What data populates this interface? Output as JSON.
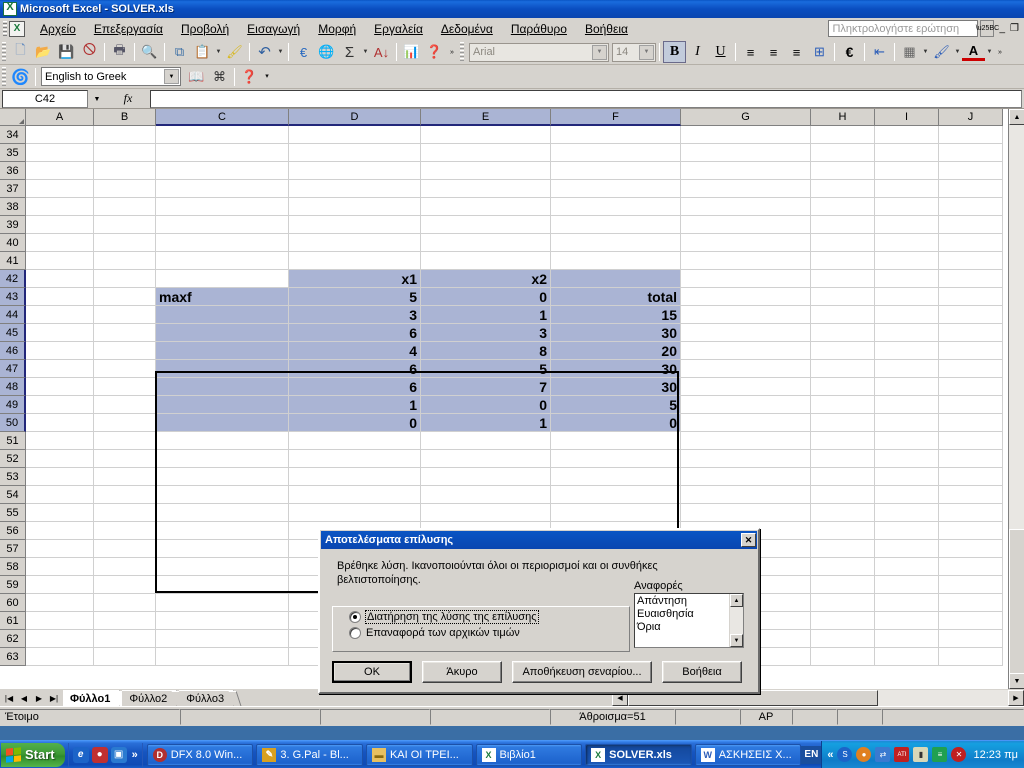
{
  "window": {
    "title": "Microsoft Excel - SOLVER.xls",
    "app_icon": "excel-icon",
    "minimize": "_",
    "restore": "❐",
    "close": "✕"
  },
  "menubar": {
    "items": [
      {
        "label": "Αρχείο",
        "accel": "Α"
      },
      {
        "label": "Επεξεργασία",
        "accel": "Ε"
      },
      {
        "label": "Προβολή",
        "accel": "ρ"
      },
      {
        "label": "Εισαγωγή",
        "accel": "ω"
      },
      {
        "label": "Μορφή",
        "accel": "Μ"
      },
      {
        "label": "Εργαλεία",
        "accel": "λ"
      },
      {
        "label": "Δεδομένα",
        "accel": "Δ"
      },
      {
        "label": "Παράθυρο",
        "accel": "θ"
      },
      {
        "label": "Βοήθεια",
        "accel": "Β"
      }
    ],
    "ask_box_placeholder": "Πληκτρολογήστε ερώτηση"
  },
  "standard_toolbar": {
    "buttons": [
      {
        "name": "new-icon",
        "glyph": "📄"
      },
      {
        "name": "open-icon",
        "glyph": "📂"
      },
      {
        "name": "save-icon",
        "glyph": "💾"
      },
      {
        "name": "permission-icon",
        "glyph": "📑"
      },
      {
        "name": "print-icon",
        "glyph": "🖨"
      },
      {
        "name": "print-preview-icon",
        "glyph": "🔍"
      },
      {
        "name": "copy-icon",
        "glyph": "⧉"
      },
      {
        "name": "paste-icon",
        "glyph": "📋"
      },
      {
        "name": "format-painter-icon",
        "glyph": "🖌"
      },
      {
        "name": "undo-icon",
        "glyph": "↶"
      },
      {
        "name": "euro-convert-icon",
        "glyph": "€"
      },
      {
        "name": "insert-hyperlink-icon",
        "glyph": "🌐"
      },
      {
        "name": "autosum-icon",
        "glyph": "Σ"
      },
      {
        "name": "sort-ascending-icon",
        "glyph": "↓"
      },
      {
        "name": "chart-wizard-icon",
        "glyph": "📊"
      },
      {
        "name": "help-icon",
        "glyph": "?"
      }
    ],
    "toolbar_options": "»"
  },
  "formatting_toolbar": {
    "font_name": "Arial",
    "font_size": "14",
    "bold": "B",
    "italic": "I",
    "underline": "U",
    "align_left": "≡",
    "align_center": "≡",
    "align_right": "≡",
    "merge_cells": "⊞",
    "currency": "€",
    "decrease_indent": "⇤",
    "borders": "▦",
    "fill_color": "🪣",
    "font_color": "A"
  },
  "translation_toolbar": {
    "icon": "translate-icon",
    "selected_language": "English to Greek",
    "buttons": [
      {
        "name": "dictionary-icon",
        "glyph": "📖"
      },
      {
        "name": "translate-page-icon",
        "glyph": "⌘"
      },
      {
        "name": "translation-help-icon",
        "glyph": "?"
      }
    ]
  },
  "formula_bar": {
    "name_box": "C42",
    "formula": ""
  },
  "grid": {
    "columns": [
      {
        "label": "A",
        "width": 68,
        "selected": false
      },
      {
        "label": "B",
        "width": 62,
        "selected": false
      },
      {
        "label": "C",
        "width": 133,
        "selected": true
      },
      {
        "label": "D",
        "width": 132,
        "selected": true
      },
      {
        "label": "E",
        "width": 130,
        "selected": true
      },
      {
        "label": "F",
        "width": 130,
        "selected": true
      },
      {
        "label": "G",
        "width": 130,
        "selected": false
      },
      {
        "label": "H",
        "width": 64,
        "selected": false
      },
      {
        "label": "I",
        "width": 64,
        "selected": false
      },
      {
        "label": "J",
        "width": 64,
        "selected": false
      }
    ],
    "rows": [
      {
        "num": "34",
        "selected": false,
        "cells": {}
      },
      {
        "num": "35",
        "selected": false,
        "cells": {}
      },
      {
        "num": "36",
        "selected": false,
        "cells": {}
      },
      {
        "num": "37",
        "selected": false,
        "cells": {}
      },
      {
        "num": "38",
        "selected": false,
        "cells": {}
      },
      {
        "num": "39",
        "selected": false,
        "cells": {}
      },
      {
        "num": "40",
        "selected": false,
        "cells": {}
      },
      {
        "num": "41",
        "selected": false,
        "cells": {}
      },
      {
        "num": "42",
        "selected": true,
        "cells": {
          "C": "",
          "D": "x1",
          "E": "x2",
          "F": ""
        }
      },
      {
        "num": "43",
        "selected": true,
        "cells": {
          "C": "maxf",
          "D": "5",
          "E": "0",
          "F": "total"
        }
      },
      {
        "num": "44",
        "selected": true,
        "cells": {
          "C": "",
          "D": "3",
          "E": "1",
          "F": "15"
        }
      },
      {
        "num": "45",
        "selected": true,
        "cells": {
          "C": "",
          "D": "6",
          "E": "3",
          "F": "30"
        }
      },
      {
        "num": "46",
        "selected": true,
        "cells": {
          "C": "",
          "D": "4",
          "E": "8",
          "F": "20"
        }
      },
      {
        "num": "47",
        "selected": true,
        "cells": {
          "C": "",
          "D": "6",
          "E": "5",
          "F": "30"
        }
      },
      {
        "num": "48",
        "selected": true,
        "cells": {
          "C": "",
          "D": "6",
          "E": "7",
          "F": "30"
        }
      },
      {
        "num": "49",
        "selected": true,
        "cells": {
          "C": "",
          "D": "1",
          "E": "0",
          "F": "5"
        }
      },
      {
        "num": "50",
        "selected": true,
        "cells": {
          "C": "",
          "D": "0",
          "E": "1",
          "F": "0"
        }
      },
      {
        "num": "51",
        "selected": false,
        "cells": {}
      },
      {
        "num": "52",
        "selected": false,
        "cells": {}
      },
      {
        "num": "53",
        "selected": false,
        "cells": {}
      },
      {
        "num": "54",
        "selected": false,
        "cells": {}
      },
      {
        "num": "55",
        "selected": false,
        "cells": {}
      },
      {
        "num": "56",
        "selected": false,
        "cells": {}
      },
      {
        "num": "57",
        "selected": false,
        "cells": {}
      },
      {
        "num": "58",
        "selected": false,
        "cells": {}
      },
      {
        "num": "59",
        "selected": false,
        "cells": {}
      },
      {
        "num": "60",
        "selected": false,
        "cells": {}
      },
      {
        "num": "61",
        "selected": false,
        "cells": {}
      },
      {
        "num": "62",
        "selected": false,
        "cells": {}
      },
      {
        "num": "63",
        "selected": false,
        "cells": {}
      }
    ],
    "selection_range": "C42:F50",
    "numeric_columns": [
      "D",
      "E",
      "F"
    ]
  },
  "sheet_tabs": {
    "nav_first": "⏮",
    "nav_prev": "◀",
    "nav_next": "▶",
    "nav_last": "⏭",
    "tabs": [
      {
        "label": "Φύλλο1",
        "active": true
      },
      {
        "label": "Φύλλο2",
        "active": false
      },
      {
        "label": "Φύλλο3",
        "active": false
      }
    ]
  },
  "status_bar": {
    "mode": "Έτοιμο",
    "sum": "Άθροισμα=51",
    "num_lock": "ΑΡ"
  },
  "dialog": {
    "title": "Αποτελέσματα επίλυσης",
    "close_glyph": "✕",
    "message": "Βρέθηκε λύση.  Ικανοποιούνται όλοι οι περιορισμοί και οι συνθήκες βελτιστοποίησης.",
    "radio_options": [
      {
        "label": "Διατήρηση της λύσης της επίλυσης",
        "selected": true
      },
      {
        "label": "Επαναφορά των αρχικών τιμών",
        "selected": false
      }
    ],
    "reports_label": "Αναφορές",
    "reports": [
      "Απάντηση",
      "Ευαισθησία",
      "Όρια"
    ],
    "buttons": [
      {
        "label": "OK",
        "default": true,
        "width": 80
      },
      {
        "label": "Άκυρο",
        "default": false,
        "width": 80
      },
      {
        "label": "Αποθήκευση σεναρίου...",
        "default": false,
        "width": 140
      },
      {
        "label": "Βοήθεια",
        "default": false,
        "width": 80
      }
    ],
    "scroll_up": "▲",
    "scroll_down": "▼"
  },
  "taskbar": {
    "start_label": "Start",
    "quick_launch": [
      {
        "name": "internet-explorer-icon",
        "glyph": "e",
        "color": "#1c64c8"
      },
      {
        "name": "media-player-icon",
        "glyph": "●",
        "color": "#c03030"
      },
      {
        "name": "show-desktop-icon",
        "glyph": "▣",
        "color": "#2a7ad0"
      }
    ],
    "quick_launch_overflow": "»",
    "tasks": [
      {
        "label": "DFX 8.0 Win...",
        "icon_color": "#b03030",
        "icon_text": "D",
        "active": false
      },
      {
        "label": "3. G.Pal - Bl...",
        "icon_color": "#d8a020",
        "icon_text": "✒",
        "active": false
      },
      {
        "label": "ΚΑΙ ΟΙ ΤΡΕΙ...",
        "icon_color": "#e8c060",
        "icon_text": "📁",
        "active": false
      },
      {
        "label": "Βιβλίο1",
        "icon_color": "#1a7a3c",
        "icon_text": "X",
        "active": false
      },
      {
        "label": "SOLVER.xls",
        "icon_color": "#1a7a3c",
        "icon_text": "X",
        "active": true
      },
      {
        "label": "ΑΣΚΗΣΕΙΣ Χ...",
        "icon_color": "#2a5cb8",
        "icon_text": "W",
        "active": false
      }
    ],
    "language": "EN",
    "tray_overflow": "«",
    "tray": [
      {
        "name": "systran-tray-icon",
        "glyph": "S",
        "color": "#1c64c8"
      },
      {
        "name": "firewall-tray-icon",
        "glyph": "●",
        "color": "#e08020"
      },
      {
        "name": "network-tray-icon",
        "glyph": "⇄",
        "color": "#3a7ad0"
      },
      {
        "name": "ati-tray-icon",
        "glyph": "ATI",
        "color": "#c02020"
      },
      {
        "name": "volume-tray-icon",
        "glyph": "🔊",
        "color": "#d0d0b0"
      },
      {
        "name": "messenger-tray-icon",
        "glyph": "≡",
        "color": "#20a050"
      },
      {
        "name": "antivirus-tray-icon",
        "glyph": "✕",
        "color": "#c02020"
      }
    ],
    "clock": "12:23 πμ"
  }
}
